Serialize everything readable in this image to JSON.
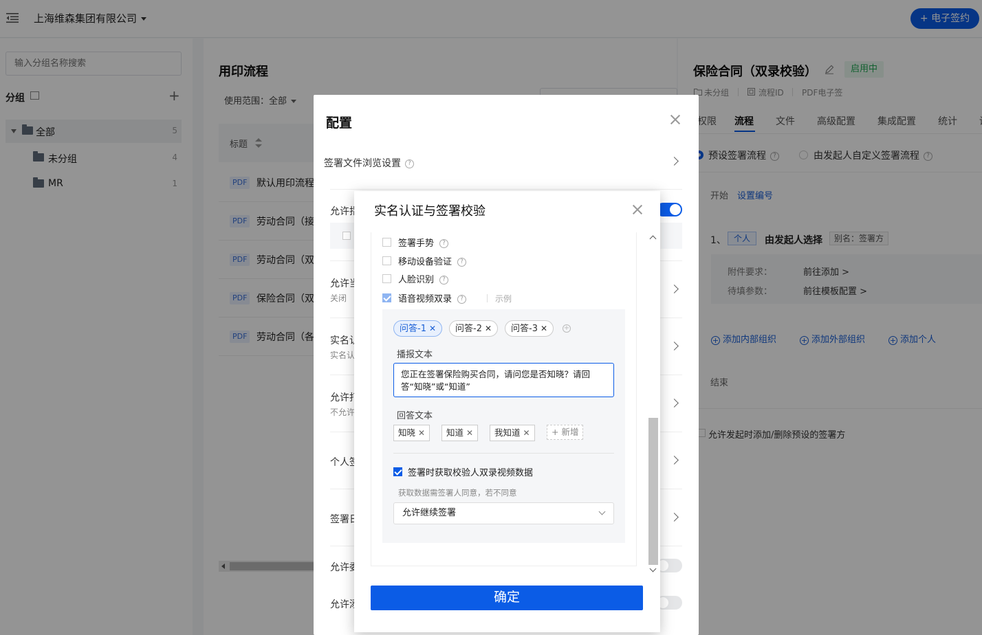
{
  "topbar": {
    "company": "上海维森集团有限公司",
    "esign_button": "+ 电子签约"
  },
  "group_panel": {
    "search_placeholder": "输入分组名称搜索",
    "title": "分组",
    "add_symbol": "+",
    "tree": [
      {
        "label": "全部",
        "count": "5"
      },
      {
        "label": "未分组",
        "count": "4"
      },
      {
        "label": "MR",
        "count": "1"
      }
    ]
  },
  "list_panel": {
    "title": "用印流程",
    "scope": "使用范围：全部",
    "column_title": "标题",
    "rows": [
      {
        "type": "PDF",
        "title": "默认用印流程"
      },
      {
        "type": "PDF",
        "title": "劳动合同（接收"
      },
      {
        "type": "PDF",
        "title": "劳动合同（双方"
      },
      {
        "type": "PDF",
        "title": "保险合同（双录"
      },
      {
        "type": "PDF",
        "title": "劳动合同（各种"
      }
    ]
  },
  "detail_panel": {
    "title": "保险合同（双录校验）",
    "status": "启用中",
    "meta": [
      "未分组",
      "流程ID",
      "PDF电子签"
    ],
    "tabs": [
      "权限",
      "流程",
      "文件",
      "高级配置",
      "集成配置",
      "统计",
      "设"
    ],
    "active_tab": "流程",
    "radio_preset": "预设签署流程",
    "radio_custom": "由发起人自定义签署流程",
    "start": "开始",
    "set_number": "设置编号",
    "signer_index": "1、",
    "signer_type": "个人",
    "signer_name": "由发起人选择",
    "signer_alias": "别名：签署方",
    "attach_label": "附件要求：",
    "attach_link": "前往添加 >",
    "fill_label": "待填参数：",
    "fill_link": "前往模板配置 >",
    "add_internal": "添加内部组织",
    "add_external": "添加外部组织",
    "add_person": "添加个人",
    "end": "结束",
    "allow_text": "允许发起时添加/删除预设的签署方"
  },
  "config_dialog": {
    "title": "配置",
    "rows": [
      {
        "title": "签署文件浏览设置",
        "sub": ""
      },
      {
        "title": "允许指",
        "sub": ""
      },
      {
        "title": "允许当",
        "sub": "关闭"
      },
      {
        "title": "实名认",
        "sub": "实名认"
      },
      {
        "title": "允许打",
        "sub": "不允许"
      },
      {
        "title": "个人签",
        "sub": ""
      },
      {
        "title": "签署日",
        "sub": ""
      },
      {
        "title": "允许委",
        "sub": ""
      },
      {
        "title": "允许添",
        "sub": ""
      }
    ]
  },
  "inner_dialog": {
    "title": "实名认证与签署校验",
    "items": [
      {
        "label": "签署手势",
        "checked": false
      },
      {
        "label": "移动设备验证",
        "checked": false
      },
      {
        "label": "人脸识别",
        "checked": false
      },
      {
        "label": "语音视频双录",
        "checked": true
      }
    ],
    "sample": "示例",
    "questions": [
      "问答-1",
      "问答-2",
      "问答-3"
    ],
    "broadcast_label": "播报文本",
    "broadcast_text": "您正在签署保险购买合同，请问您是否知晓？请回答“知晓”或“知道”",
    "answer_label": "回答文本",
    "answers": [
      "知晓",
      "知道",
      "我知道"
    ],
    "add_answer": "+ 新增",
    "fetch_label": "签署时获取校验人双录视频数据",
    "fetch_hint": "获取数据需签署人同意，若不同意",
    "fetch_option": "允许继续签署",
    "confirm": "确定"
  }
}
